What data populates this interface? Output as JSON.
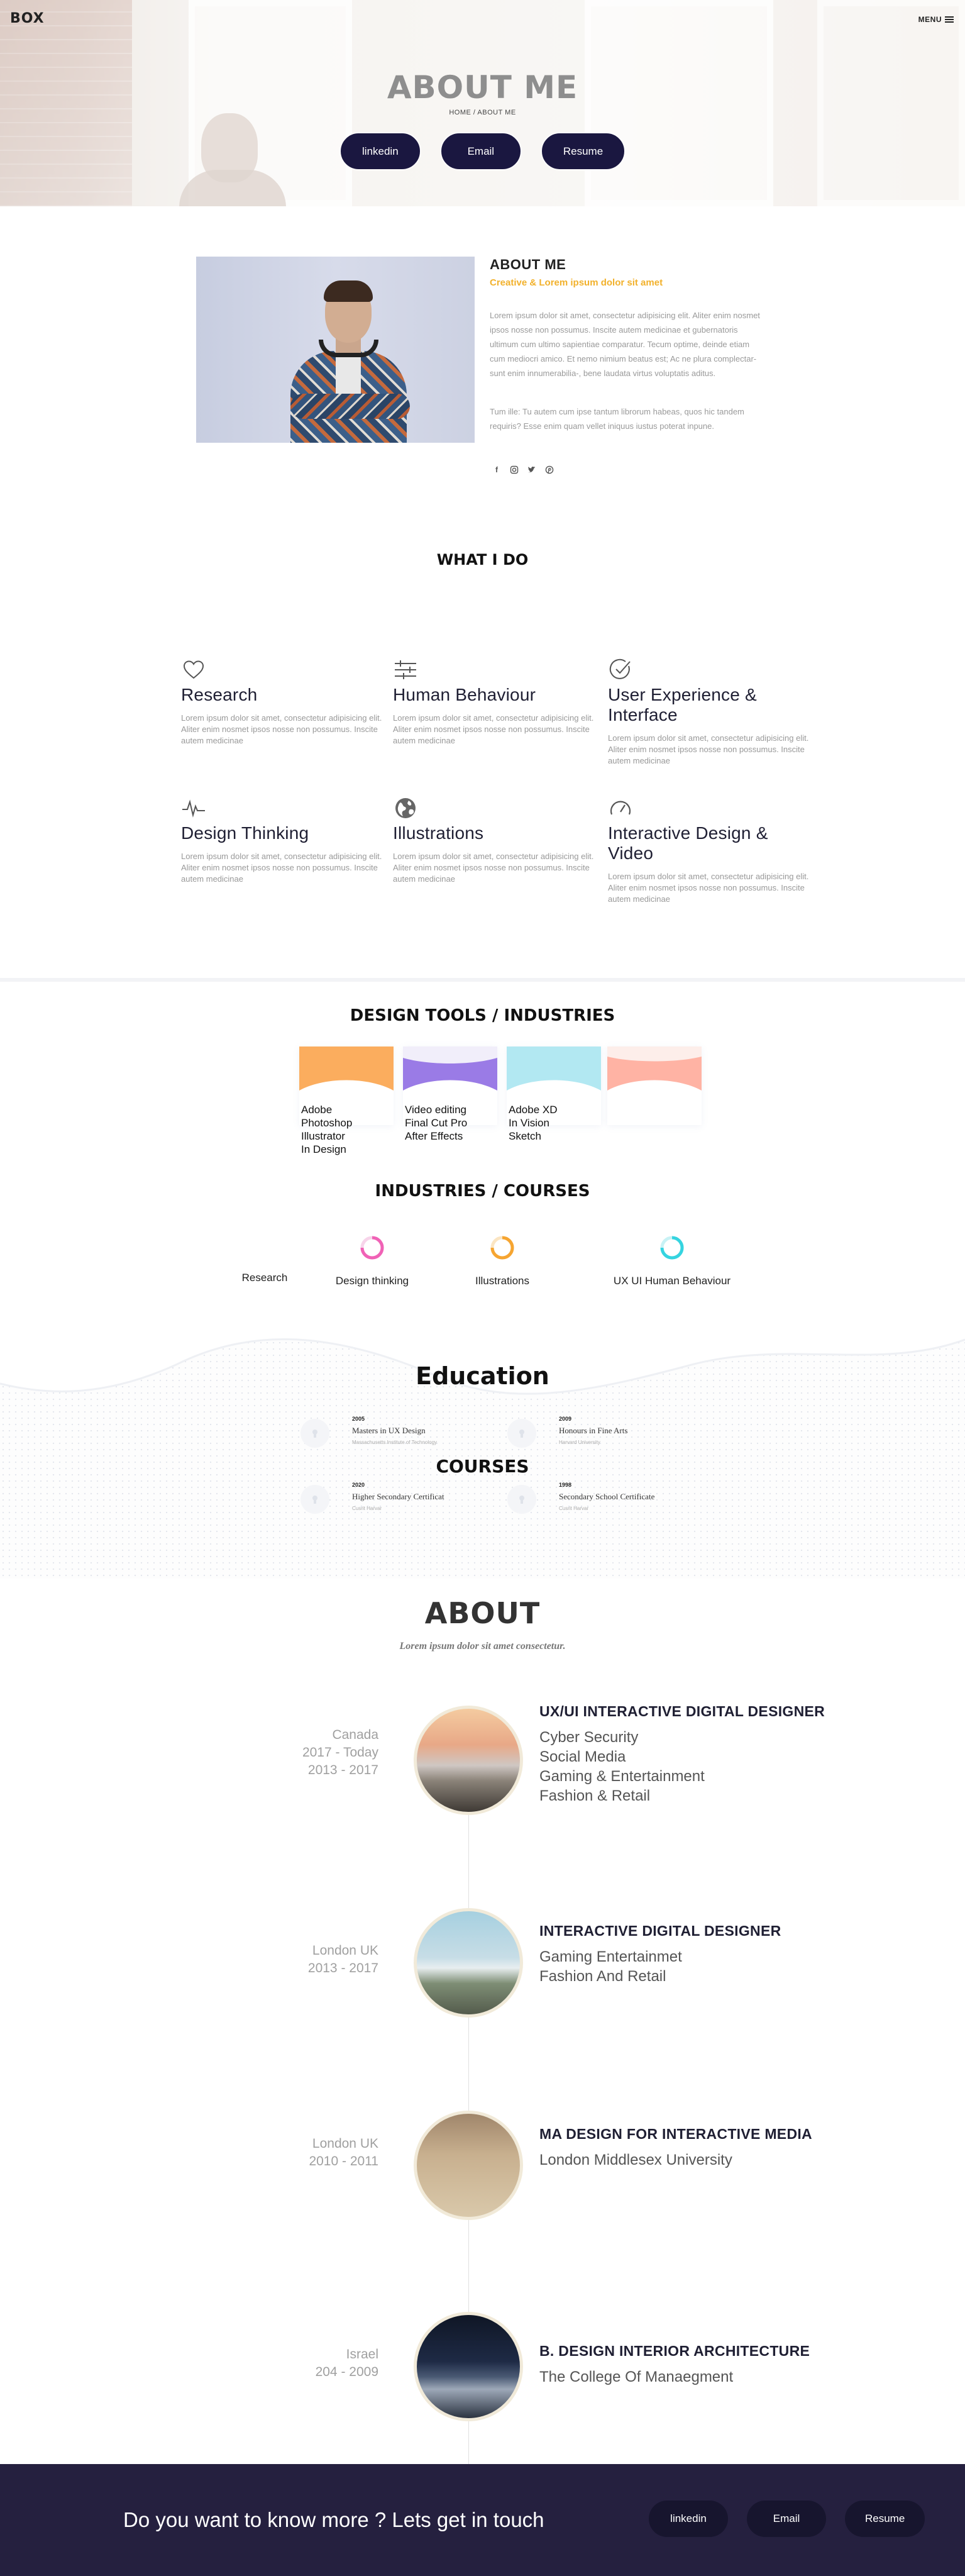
{
  "header": {
    "logo": "BOX",
    "menu_label": "MENU",
    "menu_icon": "hamburger-icon"
  },
  "hero": {
    "title": "ABOUT ME",
    "breadcrumb": "HOME / ABOUT ME",
    "buttons": [
      "linkedin",
      "Email",
      "Resume"
    ]
  },
  "about": {
    "heading": "ABOUT ME",
    "subheading": "Creative & Lorem ipsum dolor sit amet",
    "paragraph1": "Lorem ipsum dolor sit amet, consectetur adipisicing elit. Aliter enim nosmet ipsos nosse non possumus. Inscite autem medicinae et gubernatoris ultimum cum ultimo sapientiae comparatur. Tecum optime, deinde etiam cum mediocri amico. Et nemo nimium beatus est; Ac ne plura complectar-sunt enim innumerabilia-, bene laudata virtus voluptatis aditus.",
    "paragraph2": "Tum ille: Tu autem cum ipse tantum librorum habeas, quos hic tandem requiris? Esse enim quam vellet iniquus iustus poterat inpune.",
    "social_icons": [
      "facebook-icon",
      "instagram-icon",
      "twitter-icon",
      "pinterest-icon"
    ]
  },
  "what_i_do": {
    "title": "WHAT I DO",
    "services": [
      {
        "icon": "heart-icon",
        "title": "Research",
        "text": "Lorem ipsum dolor sit amet, consectetur adipisicing elit. Aliter enim nosmet ipsos nosse non possumus. Inscite autem medicinae"
      },
      {
        "icon": "sliders-icon",
        "title": "Human Behaviour",
        "text": "Lorem ipsum dolor sit amet, consectetur adipisicing elit. Aliter enim nosmet ipsos nosse non possumus. Inscite autem medicinae"
      },
      {
        "icon": "check-circle-icon",
        "title": "User Experience & Interface",
        "text": "Lorem ipsum dolor sit amet, consectetur adipisicing elit. Aliter enim nosmet ipsos nosse non possumus. Inscite autem medicinae"
      },
      {
        "icon": "pulse-icon",
        "title": "Design Thinking",
        "text": "Lorem ipsum dolor sit amet, consectetur adipisicing elit. Aliter enim nosmet ipsos nosse non possumus. Inscite autem medicinae"
      },
      {
        "icon": "globe-icon",
        "title": "Illustrations",
        "text": "Lorem ipsum dolor sit amet, consectetur adipisicing elit. Aliter enim nosmet ipsos nosse non possumus. Inscite autem medicinae"
      },
      {
        "icon": "gauge-icon",
        "title": "Interactive Design  & Video",
        "text": "Lorem ipsum dolor sit amet, consectetur adipisicing elit. Aliter enim nosmet ipsos nosse non possumus. Inscite autem medicinae"
      }
    ]
  },
  "design_tools": {
    "title": "DESIGN TOOLS / INDUSTRIES",
    "cards": [
      {
        "color": "#fbad5e",
        "items": [
          "Adobe",
          "Photoshop",
          "Illustrator",
          "In Design"
        ]
      },
      {
        "color": "#9a7be6",
        "items": [
          "Video editing",
          "Final Cut Pro",
          "After Effects"
        ]
      },
      {
        "color": "#b2e8f2",
        "items": [
          "Adobe XD",
          "In Vision",
          "Sketch"
        ]
      },
      {
        "color": "#ffb3a4",
        "items": []
      }
    ]
  },
  "industries": {
    "title": "INDUSTRIES / COURSES",
    "items": [
      {
        "label": "Research",
        "ring_color": ""
      },
      {
        "label": "Design thinking",
        "ring_color": "#f062b6"
      },
      {
        "label": "Illustrations",
        "ring_color": "#f6a531"
      },
      {
        "label": "UX UI Human Behaviour",
        "ring_color": "#35d4e0"
      }
    ]
  },
  "education": {
    "title": "Education",
    "courses_title": "COURSES",
    "entries": [
      {
        "year": "2005",
        "degree": "Masters in UX Design",
        "school": "Massachusetts Institute of Technology"
      },
      {
        "year": "2009",
        "degree": "Honours in Fine Arts",
        "school": "Harvard University"
      },
      {
        "year": "2020",
        "degree": "Higher Secondary Certificat",
        "school": "Cusrit Harvar"
      },
      {
        "year": "1998",
        "degree": "Secondary School Certificate",
        "school": "Cusrit Harvar"
      }
    ]
  },
  "about_timeline": {
    "title": "ABOUT",
    "subtitle": "Lorem ipsum dolor sit amet consectetur.",
    "entries": [
      {
        "left": [
          "Canada",
          "2017 - Today",
          "2013 - 2017"
        ],
        "title": "UX/UI INTERACTIVE DIGITAL DESIGNER",
        "lines": [
          "Cyber Security",
          "Social Media",
          "Gaming & Entertainment",
          "Fashion & Retail"
        ]
      },
      {
        "left": [
          "London UK",
          "2013 - 2017"
        ],
        "title": "INTERACTIVE DIGITAL DESIGNER",
        "lines": [
          "Gaming Entertainmet",
          "Fashion And Retail"
        ]
      },
      {
        "left": [
          "London UK",
          "2010 - 2011"
        ],
        "title": "MA DESIGN FOR INTERACTIVE MEDIA",
        "lines": [
          "London Middlesex University"
        ]
      },
      {
        "left": [
          "Israel",
          "204 - 2009"
        ],
        "title": "B. DESIGN INTERIOR ARCHITECTURE",
        "lines": [
          "The College Of Manaegment"
        ]
      }
    ]
  },
  "footer": {
    "text": "Do you want to know more ? Lets get in touch",
    "buttons": [
      "linkedin",
      "Email",
      "Resume"
    ]
  }
}
